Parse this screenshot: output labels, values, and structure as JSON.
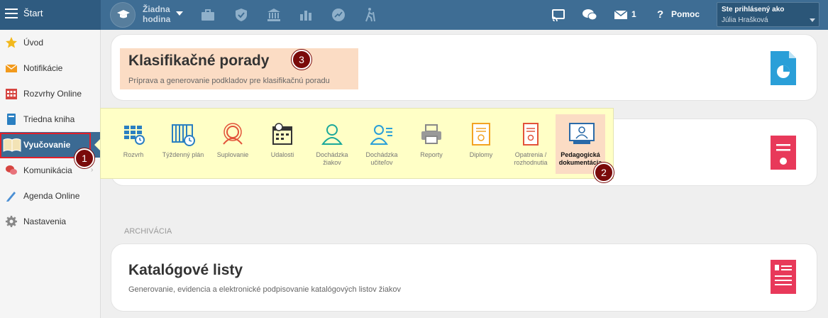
{
  "topbar": {
    "brand_label": "Štart",
    "hour_line1": "Žiadna",
    "hour_line2": "hodina",
    "mail_count": "1",
    "help_label": "Pomoc",
    "user_hint": "Ste prihlásený ako",
    "user_name": "Júlia Hrašková"
  },
  "sidebar": {
    "items": [
      {
        "label": "Úvod"
      },
      {
        "label": "Notifikácie"
      },
      {
        "label": "Rozvrhy Online"
      },
      {
        "label": "Triedna kniha"
      },
      {
        "label": "Vyučovanie"
      },
      {
        "label": "Komunikácia"
      },
      {
        "label": "Agenda Online"
      },
      {
        "label": "Nastavenia"
      }
    ]
  },
  "callouts": [
    "1",
    "2",
    "3"
  ],
  "cards": {
    "klasifikacne": {
      "title": "Klasifikačné porady",
      "desc": "Príprava a generovanie podkladov pre klasifikačnú poradu"
    },
    "katalog": {
      "title": "Katalógové listy",
      "desc": "Generovanie, evidencia a elektronické podpisovanie katalógových listov žiakov"
    }
  },
  "section_label": "ARCHIVÁCIA",
  "menu": {
    "tiles": [
      {
        "line1": "Rozvrh",
        "line2": ""
      },
      {
        "line1": "Týždenný plán",
        "line2": ""
      },
      {
        "line1": "Suplovanie",
        "line2": ""
      },
      {
        "line1": "Udalosti",
        "line2": ""
      },
      {
        "line1": "Dochádzka",
        "line2": "žiakov"
      },
      {
        "line1": "Dochádzka",
        "line2": "učiteľov"
      },
      {
        "line1": "Reporty",
        "line2": ""
      },
      {
        "line1": "Diplomy",
        "line2": ""
      },
      {
        "line1": "Opatrenia /",
        "line2": "rozhodnutia"
      },
      {
        "line1": "Pedagogická",
        "line2": "dokumentácia"
      }
    ]
  },
  "colors": {
    "topbar": "#3e6d94",
    "accent_blue": "#2a9fd8",
    "accent_red": "#e8395a",
    "highlight": "#fbdcc4",
    "menu_bg": "#ffffc6"
  }
}
